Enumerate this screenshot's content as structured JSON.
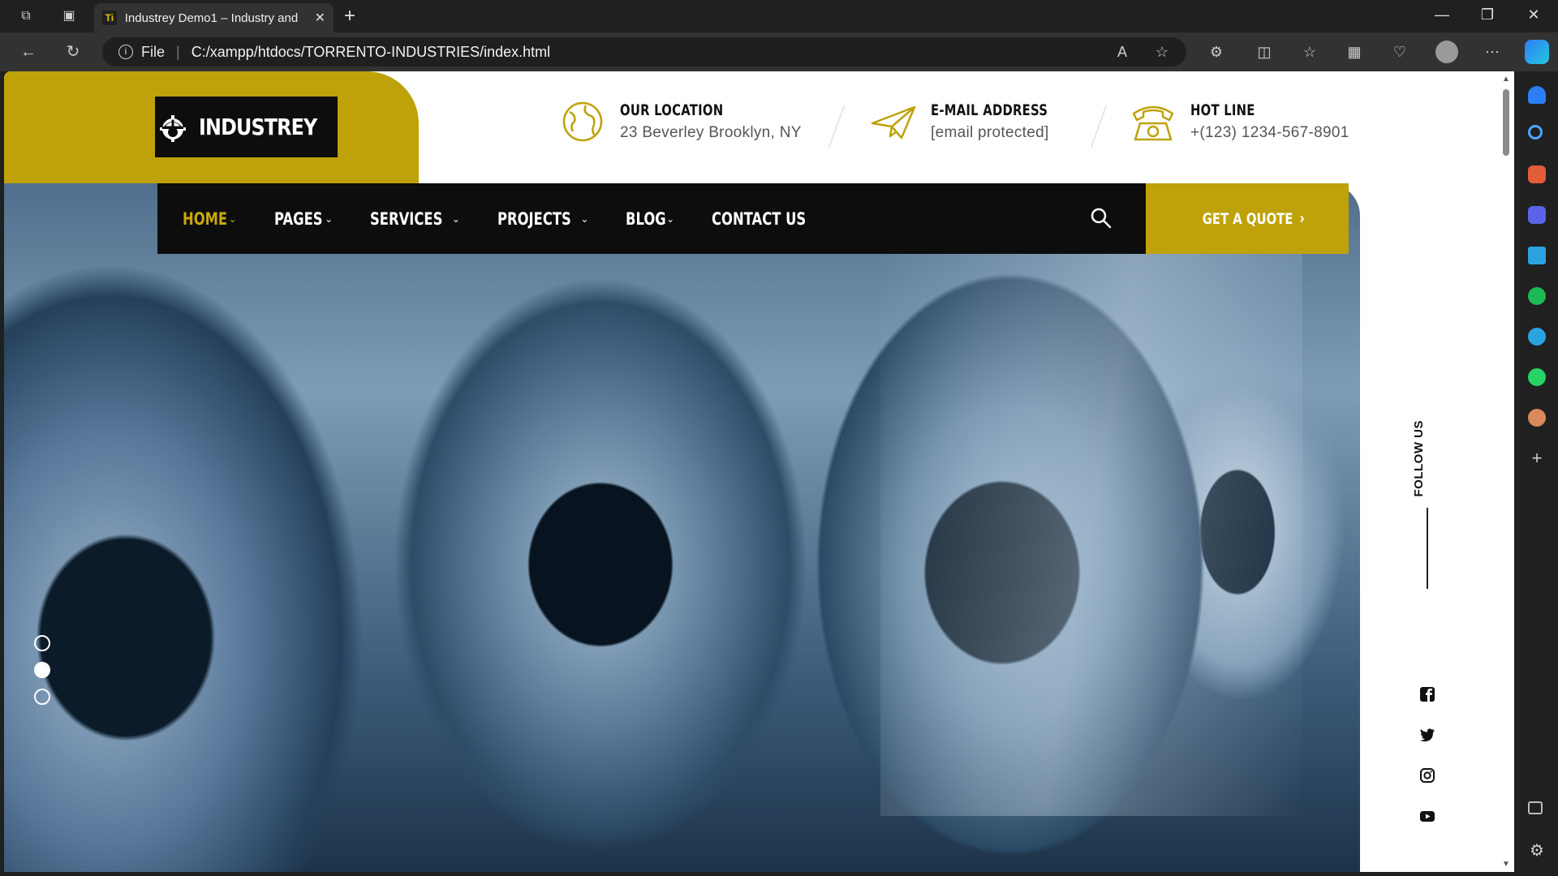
{
  "browser": {
    "tab_title": "Industrey Demo1 – Industry and",
    "tab_favicon": "Ti",
    "address_scheme": "File",
    "url": "C:/xampp/htdocs/TORRENTO-INDUSTRIES/index.html"
  },
  "site": {
    "logo_text": "INDUSTREY",
    "brand_color": "#bfa20a",
    "header": {
      "location": {
        "label": "OUR LOCATION",
        "value": "23 Beverley Brooklyn, NY",
        "icon": "globe-icon"
      },
      "email": {
        "label": "E-MAIL ADDRESS",
        "value": "[email protected]",
        "icon": "paper-plane-icon"
      },
      "hotline": {
        "label": "HOT LINE",
        "value": "+(123) 1234-567-8901",
        "icon": "telephone-icon"
      }
    },
    "nav": {
      "items": [
        {
          "label": "HOME",
          "dropdown": "⌄"
        },
        {
          "label": "PAGES",
          "dropdown": "⌄"
        },
        {
          "label": "SERVICES",
          "dropdown": "⌄"
        },
        {
          "label": "PROJECTS",
          "dropdown": "⌄"
        },
        {
          "label": "BLOG",
          "dropdown": "⌄"
        },
        {
          "label": "CONTACT US"
        }
      ],
      "active_index": 0,
      "quote_label": "GET A QUOTE",
      "quote_arrow": "›"
    },
    "slider": {
      "slides": 3,
      "active": 1
    },
    "follow_label": "FOLLOW US",
    "socials": [
      "facebook-icon",
      "twitter-icon",
      "instagram-icon",
      "youtube-icon"
    ]
  }
}
